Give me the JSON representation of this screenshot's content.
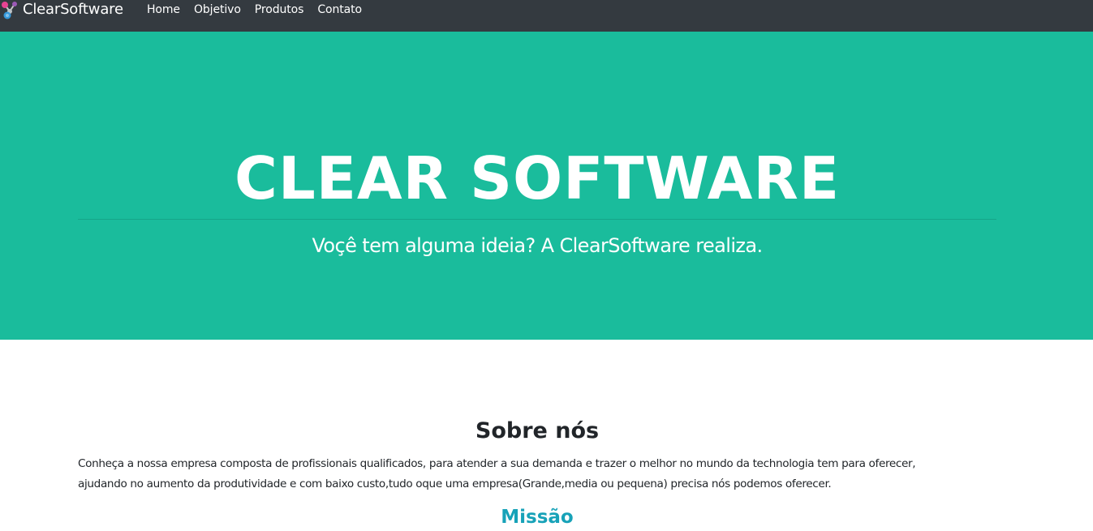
{
  "navbar": {
    "brand": "ClearSoftware",
    "logo_icon": "molecule-logo-icon",
    "links": [
      "Home",
      "Objetivo",
      "Produtos",
      "Contato"
    ],
    "background": "#343a40"
  },
  "hero": {
    "title": "CLEAR SOFTWARE",
    "subtitle": "Voçê tem alguma ideia? A ClearSoftware realiza.",
    "background": "#1abc9c"
  },
  "about": {
    "title": "Sobre nós",
    "text_line1": "Conheça a nossa empresa composta de profissionais qualificados, para atender a sua demanda e trazer o melhor no mundo da technologia tem para oferecer,",
    "text_line2": "ajudando no aumento da produtividade e com baixo custo,tudo oque uma empresa(Grande,media ou pequena) precisa nós podemos oferecer."
  },
  "mission": {
    "title": "Missão",
    "color": "#17a2b8"
  }
}
